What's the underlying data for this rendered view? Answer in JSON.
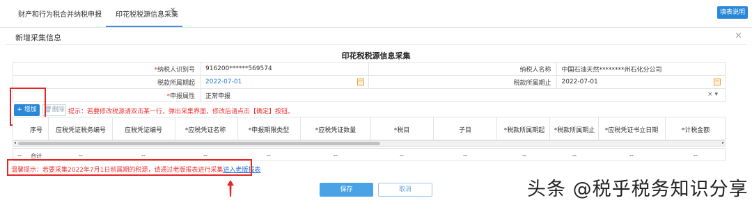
{
  "tabs": [
    {
      "label": "财产和行为税合并纳税申报",
      "active": false
    },
    {
      "label": "印花税税源信息采集",
      "active": true
    }
  ],
  "tab_close": "×",
  "help_button": "填表说明",
  "modal": {
    "title": "新增采集信息",
    "close": "×"
  },
  "form": {
    "title": "印花税税源信息采集",
    "fields": {
      "taxpayer_id_label": "纳税人识别号",
      "taxpayer_id_value": "916200******569574",
      "taxpayer_name_label": "纳税人名称",
      "taxpayer_name_value": "中国石油天然********州石化分公司",
      "period_start_label": "税款所属期起",
      "period_start_value": "2022-07-01",
      "period_end_label": "税款所属期止",
      "period_end_value": "2022-07-01",
      "declare_attr_label": "申报属性",
      "declare_attr_value": "正常申报"
    },
    "select_clear": "×",
    "select_caret": "▾"
  },
  "toolbar": {
    "add_label": "+ 增加",
    "delete_label": "删除",
    "tip": "提示：若要修改税源请双击某一行，弹出采集界面，修改后请点击【确定】按钮。"
  },
  "grid": {
    "columns": [
      "序号",
      "应税凭证税务编号",
      "应税凭证编号",
      "*应税凭证名称",
      "*申报期限类型",
      "*应税凭证数量",
      "*税目",
      "子目",
      "*税款所属期起",
      "*税款所属期止",
      "*应税凭证书立日期",
      "*计税金额"
    ],
    "total_row": [
      "--",
      "合计",
      "--",
      "--",
      "--",
      "--",
      "--",
      "--",
      "--",
      "--",
      "--",
      "--",
      "--"
    ]
  },
  "warning": {
    "text": "温馨提示：若要采集2022年7月1日前属期的税源，请通过老版报表进行采集",
    "link": "进入老版报表"
  },
  "buttons": {
    "save": "保存",
    "cancel": "取消"
  },
  "watermark": "头条 @税乎税务知识分享",
  "colors": {
    "accent": "#2a88d8",
    "warning": "#e33333",
    "highlight": "#e52424"
  }
}
